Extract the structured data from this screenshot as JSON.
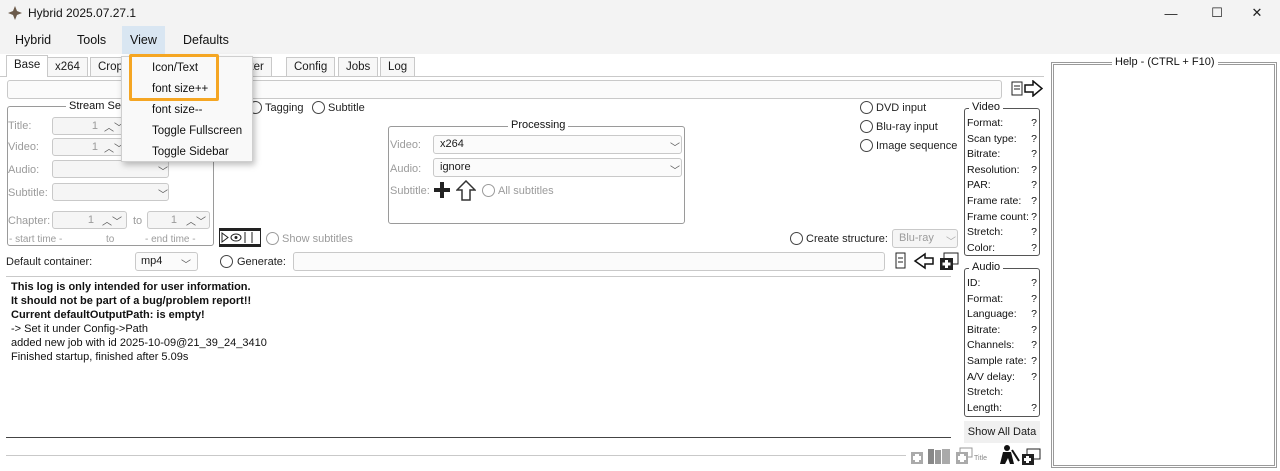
{
  "window": {
    "title": "Hybrid 2025.07.27.1",
    "minimize": "—",
    "maximize": "☐",
    "close": "✕"
  },
  "menubar": {
    "items": [
      "Hybrid",
      "Tools",
      "View",
      "Defaults"
    ]
  },
  "tabs": [
    "Base",
    "x264",
    "Crop",
    "pter",
    "Config",
    "Jobs",
    "Log"
  ],
  "view_menu": {
    "items": [
      "Icon/Text",
      "font size++",
      "font size--",
      "Toggle Fullscreen",
      "Toggle Sidebar"
    ]
  },
  "stream_selection": {
    "title": "Stream Sel",
    "title_label": "Title:",
    "title_value": "1",
    "video_label": "Video:",
    "video_value": "1",
    "audio_label": "Audio:",
    "subtitle_label": "Subtitle:",
    "chapter_label": "Chapter:",
    "chapter_from": "1",
    "chapter_to_label": "to",
    "chapter_to": "1",
    "start_time": "- start time -",
    "to": "to",
    "end_time": "- end time -"
  },
  "options": {
    "tagging": "Tagging",
    "subtitle": "Subtitle",
    "dvd_input": "DVD input",
    "bluray_input": "Blu-ray input",
    "image_sequence": "Image sequence"
  },
  "processing": {
    "title": "Processing",
    "video_label": "Video:",
    "video_value": "x264",
    "audio_label": "Audio:",
    "audio_value": "ignore",
    "subtitle_label": "Subtitle:",
    "all_subtitles": "All subtitles"
  },
  "show_subtitles": "Show subtitles",
  "create_structure": {
    "label": "Create structure:",
    "value": "Blu-ray"
  },
  "container": {
    "label": "Default container:",
    "value": "mp4"
  },
  "generate": {
    "label": "Generate:"
  },
  "log": {
    "bold_lines": [
      "This log is only intended for user information.",
      "It should not be part of a bug/problem report!!",
      "Current defaultOutputPath: is empty!"
    ],
    "lines": [
      " -> Set it under Config->Path",
      "  added new job with id 2025-10-09@21_39_24_3410",
      "Finished startup, finished after 5.09s"
    ]
  },
  "help": {
    "title": "Help - (CTRL + F10)"
  },
  "video_info": {
    "title": "Video",
    "rows": [
      {
        "label": "Format:",
        "value": "?"
      },
      {
        "label": "Scan type:",
        "value": "?"
      },
      {
        "label": "Bitrate:",
        "value": "?"
      },
      {
        "label": "Resolution:",
        "value": "?"
      },
      {
        "label": "PAR:",
        "value": "?"
      },
      {
        "label": "Frame rate:",
        "value": "?"
      },
      {
        "label": "Frame count:",
        "value": "?"
      },
      {
        "label": "Stretch:",
        "value": "?"
      },
      {
        "label": "Color:",
        "value": "?"
      }
    ]
  },
  "audio_info": {
    "title": "Audio",
    "rows": [
      {
        "label": "ID:",
        "value": "?"
      },
      {
        "label": "Format:",
        "value": "?"
      },
      {
        "label": "Language:",
        "value": "?"
      },
      {
        "label": "Bitrate:",
        "value": "?"
      },
      {
        "label": "Channels:",
        "value": "?"
      },
      {
        "label": "Sample rate:",
        "value": "?"
      },
      {
        "label": "A/V delay:",
        "value": "?"
      },
      {
        "label": "Stretch:",
        "value": ""
      },
      {
        "label": "Length:",
        "value": "?"
      }
    ]
  },
  "show_all_data": "Show All Data",
  "bottom_toolbar": {
    "title_label": "Title"
  }
}
